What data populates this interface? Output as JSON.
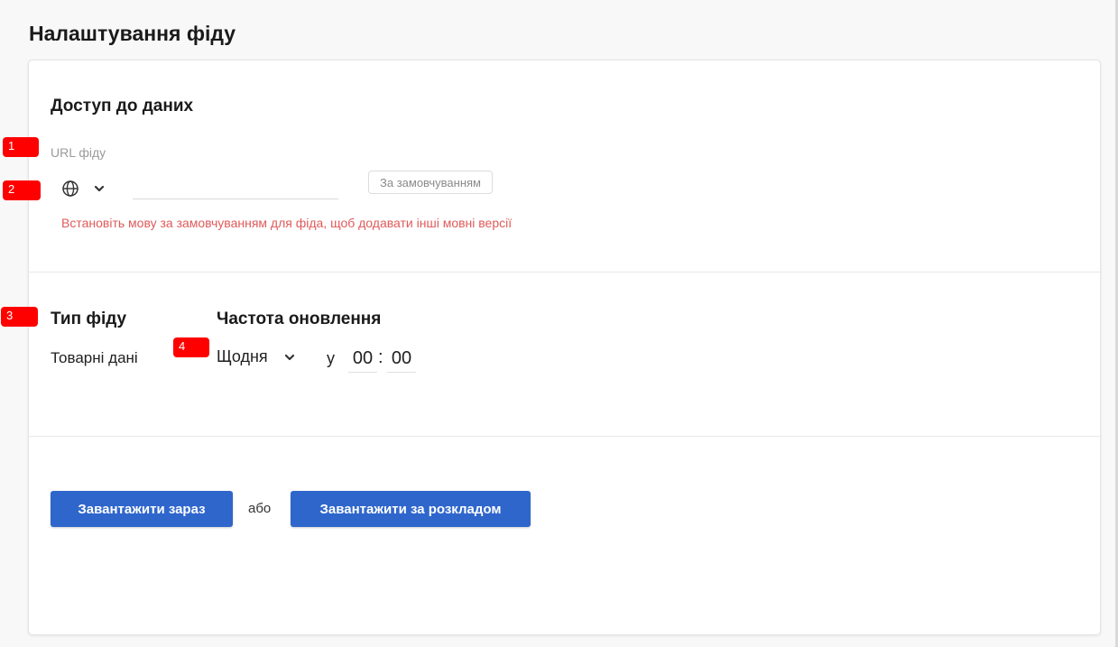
{
  "page": {
    "title": "Налаштування фіду"
  },
  "data_access": {
    "title": "Доступ до даних",
    "url_label": "URL фіду",
    "url_value": "",
    "language_icon": "globe-icon",
    "default_button": "За замовчуванням",
    "error": "Встановіть мову за замовчуванням для фіда, щоб додавати інші мовні версії"
  },
  "feed_type": {
    "title": "Тип фіду",
    "value": "Товарні дані"
  },
  "update_frequency": {
    "title": "Частота оновлення",
    "selected": "Щодня",
    "at_label": "у",
    "hours": "00",
    "separator": ":",
    "minutes": "00"
  },
  "actions": {
    "upload_now": "Завантажити зараз",
    "or": "або",
    "upload_scheduled": "Завантажити за розкладом"
  },
  "annotation_markers": [
    "1",
    "2",
    "3",
    "4"
  ],
  "colors": {
    "primary": "#2f66cc",
    "error": "#e05a5a",
    "marker": "#ff0000"
  }
}
